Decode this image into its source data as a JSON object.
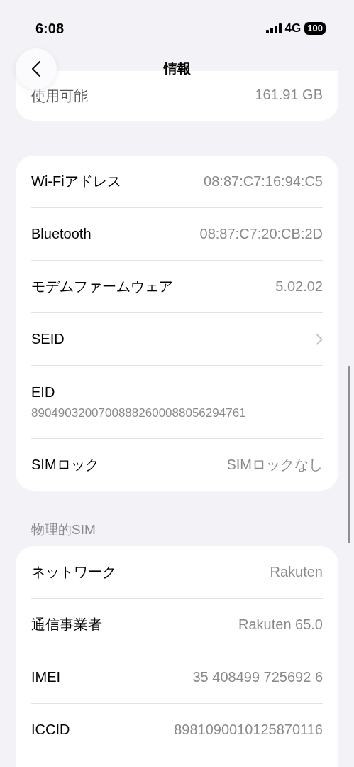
{
  "status_bar": {
    "time": "6:08",
    "network": "4G",
    "battery": "100"
  },
  "nav": {
    "title": "情報"
  },
  "storage_card": {
    "rows": [
      {
        "kind": "value",
        "label": "使用可能",
        "value": "161.91 GB"
      }
    ]
  },
  "about_card": {
    "rows": [
      {
        "kind": "value",
        "label": "Wi-Fiアドレス",
        "value": "08:87:C7:16:94:C5"
      },
      {
        "kind": "value",
        "label": "Bluetooth",
        "value": "08:87:C7:20:CB:2D"
      },
      {
        "kind": "value",
        "label": "モデムファームウェア",
        "value": "5.02.02"
      },
      {
        "kind": "chevron",
        "label": "SEID"
      },
      {
        "kind": "stacked",
        "label": "EID",
        "value": "89049032007008882600088056294761"
      },
      {
        "kind": "value",
        "label": "SIMロック",
        "value": "SIMロックなし"
      }
    ]
  },
  "physical_sim": {
    "header": "物理的SIM",
    "rows": [
      {
        "kind": "value",
        "label": "ネットワーク",
        "value": "Rakuten"
      },
      {
        "kind": "value",
        "label": "通信事業者",
        "value": "Rakuten 65.0"
      },
      {
        "kind": "value",
        "label": "IMEI",
        "value": "35 408499 725692 6"
      },
      {
        "kind": "value",
        "label": "ICCID",
        "value": "8981090010125870116"
      },
      {
        "kind": "blank"
      }
    ]
  }
}
